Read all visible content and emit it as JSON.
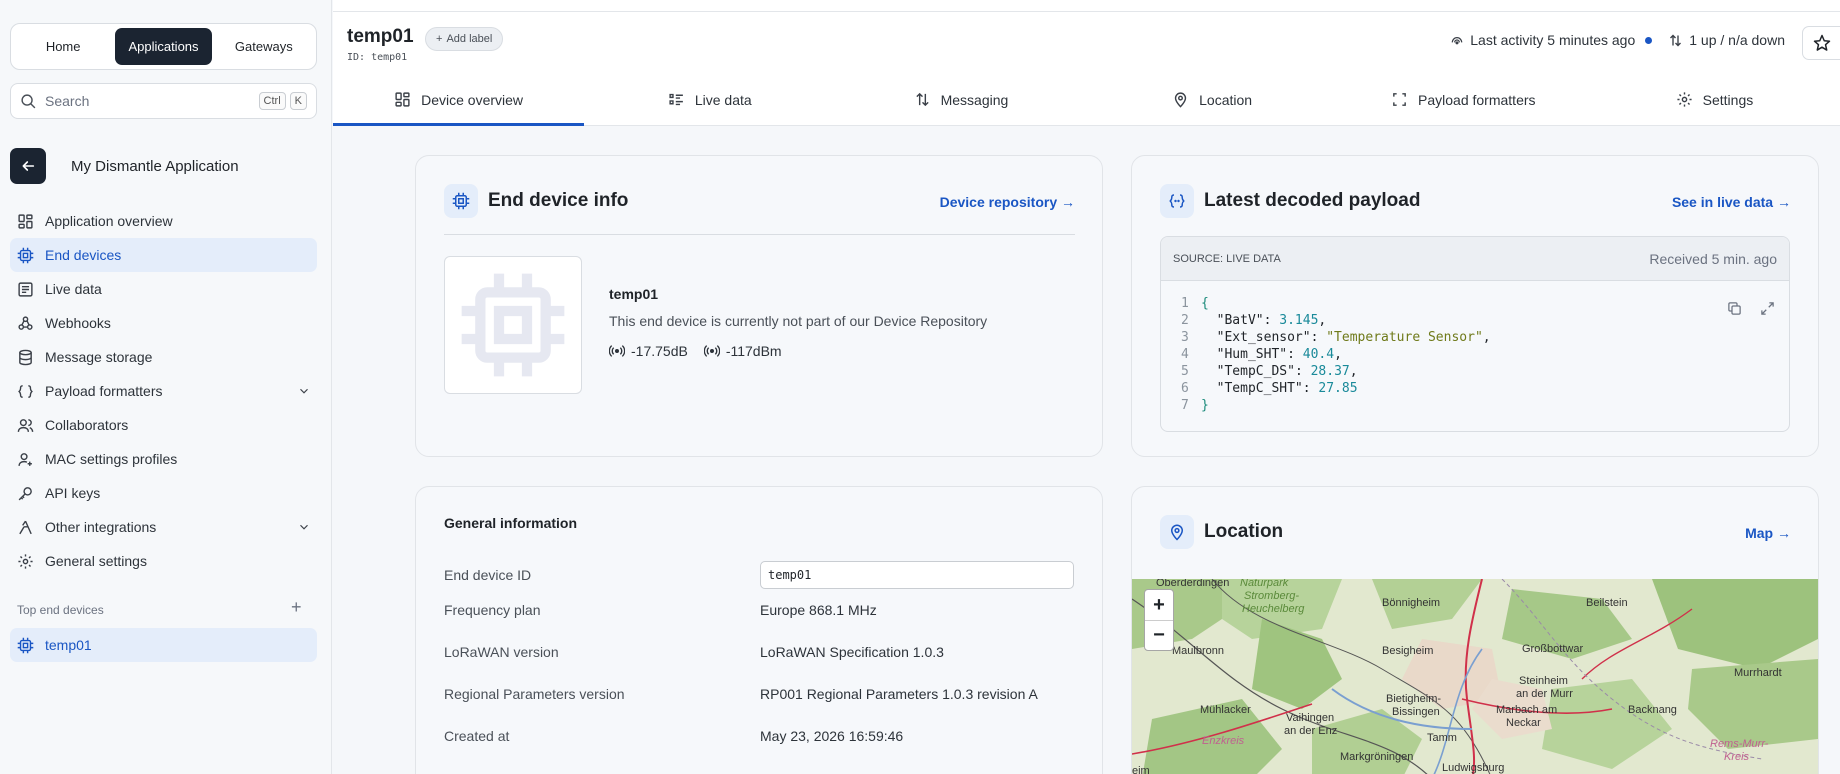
{
  "nav_switch": {
    "items": [
      "Home",
      "Applications",
      "Gateways"
    ]
  },
  "search": {
    "placeholder": "Search",
    "shortcut": [
      "Ctrl",
      "K"
    ]
  },
  "application": {
    "name": "My Dismantle Application"
  },
  "sidebar": {
    "items": [
      {
        "label": "Application overview",
        "icon": "overview-icon"
      },
      {
        "label": "End devices",
        "icon": "chip-icon"
      },
      {
        "label": "Live data",
        "icon": "list-icon"
      },
      {
        "label": "Webhooks",
        "icon": "webhook-icon"
      },
      {
        "label": "Message storage",
        "icon": "database-icon"
      },
      {
        "label": "Payload formatters",
        "icon": "code-icon"
      },
      {
        "label": "Collaborators",
        "icon": "users-icon"
      },
      {
        "label": "MAC settings profiles",
        "icon": "user-settings-icon"
      },
      {
        "label": "API keys",
        "icon": "key-icon"
      },
      {
        "label": "Other integrations",
        "icon": "integration-icon"
      },
      {
        "label": "General settings",
        "icon": "gear-icon"
      }
    ],
    "top_devices_label": "Top end devices",
    "top_devices": [
      "temp01"
    ]
  },
  "header": {
    "title": "temp01",
    "id_line": "ID: temp01",
    "add_label": "Add label",
    "last_activity": "Last activity 5 minutes ago",
    "traffic": "1 up / n/a down"
  },
  "tabs": [
    {
      "label": "Device overview"
    },
    {
      "label": "Live data"
    },
    {
      "label": "Messaging"
    },
    {
      "label": "Location"
    },
    {
      "label": "Payload formatters"
    },
    {
      "label": "Settings"
    }
  ],
  "end_device_info": {
    "title": "End device info",
    "link": "Device repository →",
    "name": "temp01",
    "description": "This end device is currently not part of our Device Repository",
    "snr": "-17.75dB",
    "rssi": "-117dBm"
  },
  "payload": {
    "title": "Latest decoded payload",
    "link": "See in live data →",
    "source": "SOURCE: LIVE DATA",
    "received": "Received 5 min. ago",
    "lines": [
      {
        "n": "1",
        "key": "",
        "val": "",
        "type": "open"
      },
      {
        "n": "2",
        "key": "\"BatV\"",
        "val": "3.145",
        "type": "num"
      },
      {
        "n": "3",
        "key": "\"Ext_sensor\"",
        "val": "\"Temperature Sensor\"",
        "type": "str"
      },
      {
        "n": "4",
        "key": "\"Hum_SHT\"",
        "val": "40.4",
        "type": "num"
      },
      {
        "n": "5",
        "key": "\"TempC_DS\"",
        "val": "28.37",
        "type": "num"
      },
      {
        "n": "6",
        "key": "\"TempC_SHT\"",
        "val": "27.85",
        "type": "num"
      },
      {
        "n": "7",
        "key": "",
        "val": "",
        "type": "close"
      }
    ]
  },
  "general_info": {
    "title": "General information",
    "rows": [
      {
        "key": "End device ID",
        "value": "temp01"
      },
      {
        "key": "Frequency plan",
        "value": "Europe 868.1 MHz"
      },
      {
        "key": "LoRaWAN version",
        "value": "LoRaWAN Specification 1.0.3"
      },
      {
        "key": "Regional Parameters version",
        "value": "RP001 Regional Parameters 1.0.3 revision A"
      },
      {
        "key": "Created at",
        "value": "May 23, 2026 16:59:46"
      }
    ]
  },
  "location": {
    "title": "Location",
    "link": "Map →",
    "zoom_in": "+",
    "zoom_out": "−",
    "places": [
      "Oberderdingen",
      "Naturpark",
      "Stromberg-",
      "Heuchelberg",
      "Bönnigheim",
      "Beilstein",
      "Maulbronn",
      "Besigheim",
      "Großbottwar",
      "Murrhardt",
      "Steinheim",
      "an der Murr",
      "Bietigheim-",
      "Bissingen",
      "Marbach am",
      "Neckar",
      "Backnang",
      "Mühlacker",
      "Vaihingen",
      "an der Enz",
      "Enzkreis",
      "Tamm",
      "Rems-Murr-",
      "Kreis",
      "Markgröningen",
      "Ludwigsburg",
      "eim"
    ]
  }
}
